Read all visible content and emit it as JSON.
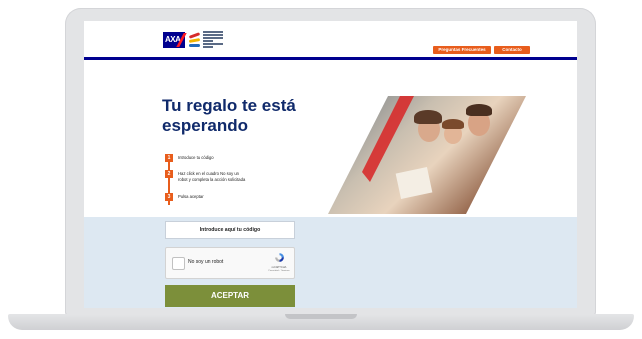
{
  "header": {
    "faq_label": "Preguntas Frecuentes",
    "contact_label": "Contacto",
    "brand_logo_text": "AXA"
  },
  "hero": {
    "title": "Tu regalo te está esperando",
    "steps": [
      {
        "num": "1",
        "text": "Introduce tu código"
      },
      {
        "num": "2",
        "text": "Haz click en el cuadro No soy un robot y completa la acción solicitada"
      },
      {
        "num": "3",
        "text": "Pulsa aceptar"
      }
    ]
  },
  "form": {
    "code_placeholder": "Introduce aquí tu código",
    "captcha_label": "No soy un robot",
    "captcha_brand": "reCAPTCHA",
    "captcha_links": "Privacidad - Términos",
    "accept_label": "ACEPTAR"
  },
  "colors": {
    "brand_blue": "#00008f",
    "title_navy": "#102a6b",
    "accent_orange": "#e85d1c",
    "accept_green": "#7c8f3a",
    "form_bg": "#dde8f2"
  }
}
